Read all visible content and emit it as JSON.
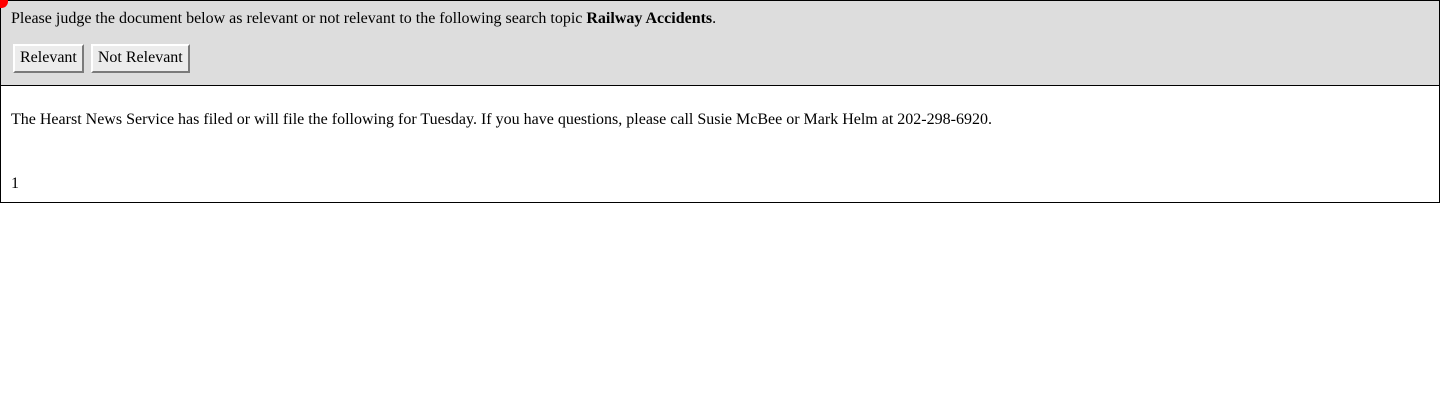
{
  "judge": {
    "instruction_prefix": "Please judge the document below as relevant or not relevant to the following search topic ",
    "topic": "Railway Accidents",
    "instruction_suffix": ".",
    "relevant_label": "Relevant",
    "not_relevant_label": "Not Relevant"
  },
  "document": {
    "text": "The Hearst News Service has filed or will file the following for Tuesday. If you have questions, please call Susie McBee or Mark Helm at 202-298-6920.",
    "page_number": "1"
  },
  "colors": {
    "panel_background": "#dddddd",
    "cursor_indicator": "#ff0000",
    "border": "#000000"
  }
}
